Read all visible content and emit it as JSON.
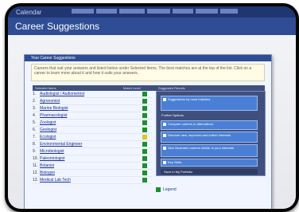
{
  "top": {
    "user_label": "Calendar",
    "tabs": [
      "",
      "",
      "",
      "",
      "",
      "",
      ""
    ]
  },
  "page": {
    "title": "Career Suggestions"
  },
  "panel": {
    "title": "Your Career Suggestions",
    "description": "Careers that suit your answers and listed below under Selected Items. The best matches are at the top of the list. Click on a career to learn more about it and how it suits your answers."
  },
  "table": {
    "headers": {
      "selected": "Selected Items",
      "match": "Match Level",
      "suggestion": "Suggested Results"
    }
  },
  "careers": [
    {
      "num": "1.",
      "name": "Audiologist / Audiometrist",
      "status": "green"
    },
    {
      "num": "2.",
      "name": "Agronomist",
      "status": "green"
    },
    {
      "num": "3.",
      "name": "Marine Biologist",
      "status": "green"
    },
    {
      "num": "4.",
      "name": "Pharmacologist",
      "status": "green"
    },
    {
      "num": "5.",
      "name": "Zoologist",
      "status": "green"
    },
    {
      "num": "6.",
      "name": "Geologist",
      "status": "green"
    },
    {
      "num": "7.",
      "name": "Ecologist",
      "status": "yellow"
    },
    {
      "num": "8.",
      "name": "Environmental Engineer",
      "status": "green"
    },
    {
      "num": "9.",
      "name": "Microbiologist",
      "status": "green"
    },
    {
      "num": "10.",
      "name": "Paleontologist",
      "status": "green"
    },
    {
      "num": "11.",
      "name": "Botanist",
      "status": "green"
    },
    {
      "num": "12.",
      "name": "Biologist",
      "status": "green"
    },
    {
      "num": "13.",
      "name": "Medical Lab Tech",
      "status": "green"
    }
  ],
  "right_panel": {
    "top_option": "Suggestions by most matches",
    "subtitle": "Further Options",
    "options": [
      "Compare careers or Alternatives",
      "Discover new, improved and further interests",
      "New Illustrated careers similar to your interests",
      "Key Skills"
    ],
    "save_button": "Save to My Portfolio"
  },
  "legend": {
    "label": "Legend"
  },
  "colors": {
    "accent": "#2f4d94",
    "good": "#1d8f2c",
    "medium": "#d7c91f"
  }
}
